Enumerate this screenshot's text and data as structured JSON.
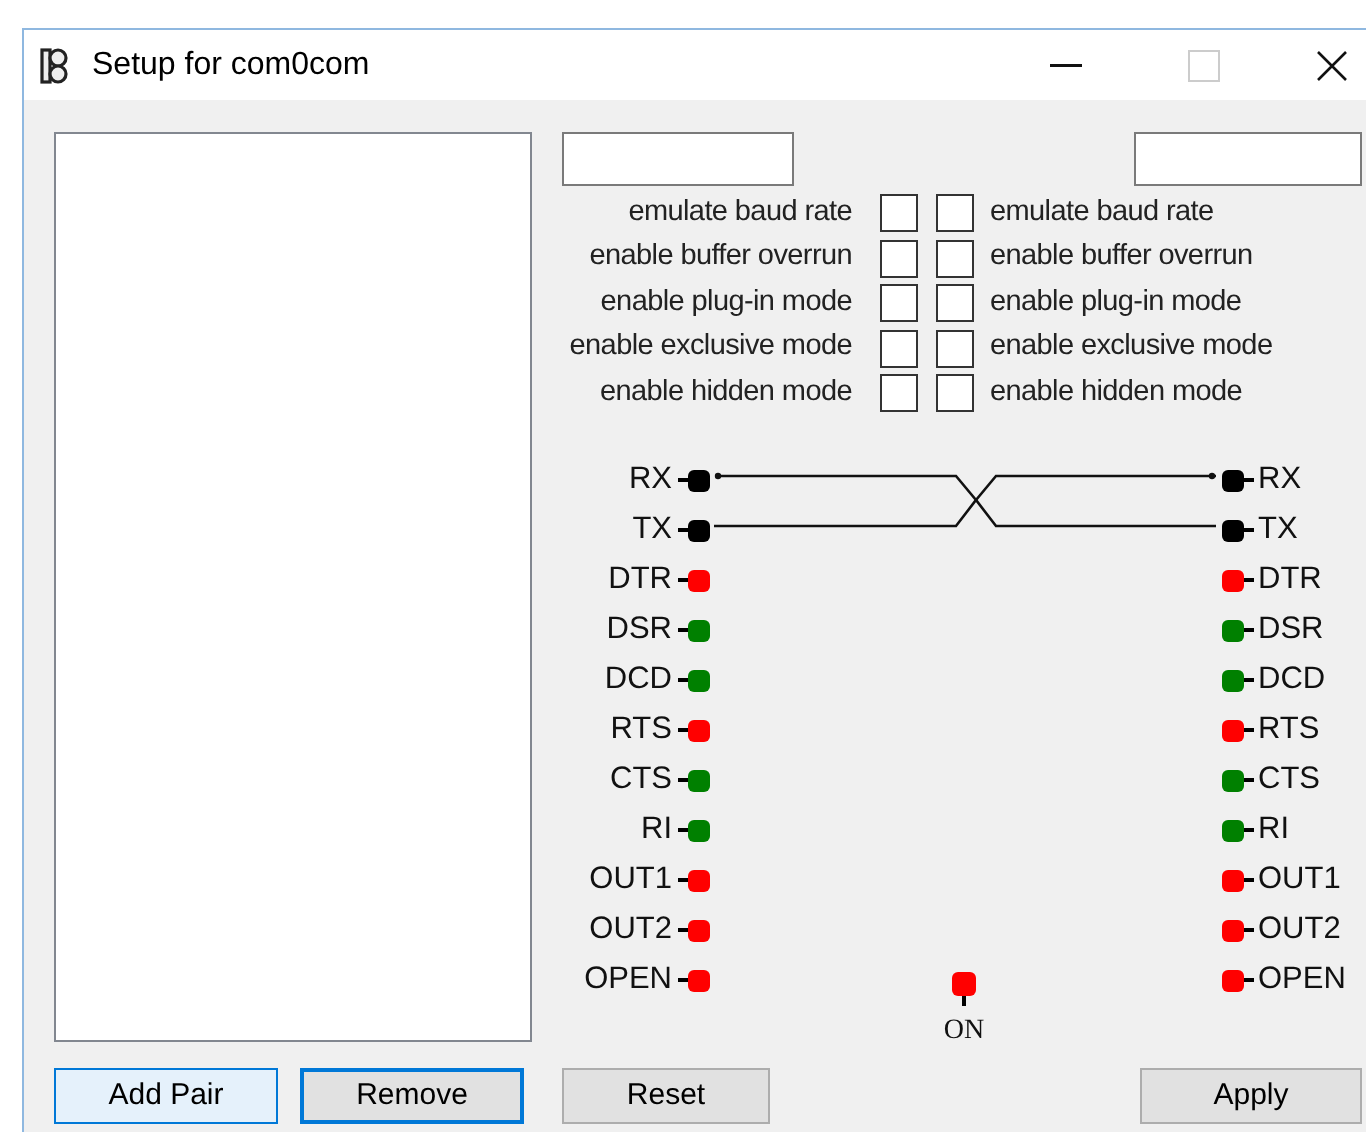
{
  "window": {
    "title": "Setup for com0com"
  },
  "options": [
    {
      "left": {
        "label": "emulate baud rate",
        "checked": false
      },
      "right": {
        "label": "emulate baud rate",
        "checked": false
      }
    },
    {
      "left": {
        "label": "enable buffer overrun",
        "checked": false
      },
      "right": {
        "label": "enable buffer overrun",
        "checked": false
      }
    },
    {
      "left": {
        "label": "enable plug-in mode",
        "checked": false
      },
      "right": {
        "label": "enable plug-in mode",
        "checked": false
      }
    },
    {
      "left": {
        "label": "enable exclusive mode",
        "checked": false
      },
      "right": {
        "label": "enable exclusive mode",
        "checked": false
      }
    },
    {
      "left": {
        "label": "enable hidden mode",
        "checked": false
      },
      "right": {
        "label": "enable hidden mode",
        "checked": false
      }
    }
  ],
  "signals": [
    {
      "left": {
        "name": "RX",
        "color": "#000000"
      },
      "right": {
        "name": "RX",
        "color": "#000000"
      }
    },
    {
      "left": {
        "name": "TX",
        "color": "#000000"
      },
      "right": {
        "name": "TX",
        "color": "#000000"
      }
    },
    {
      "left": {
        "name": "DTR",
        "color": "#ff0000"
      },
      "right": {
        "name": "DTR",
        "color": "#ff0000"
      }
    },
    {
      "left": {
        "name": "DSR",
        "color": "#008000"
      },
      "right": {
        "name": "DSR",
        "color": "#008000"
      }
    },
    {
      "left": {
        "name": "DCD",
        "color": "#008000"
      },
      "right": {
        "name": "DCD",
        "color": "#008000"
      }
    },
    {
      "left": {
        "name": "RTS",
        "color": "#ff0000"
      },
      "right": {
        "name": "RTS",
        "color": "#ff0000"
      }
    },
    {
      "left": {
        "name": "CTS",
        "color": "#008000"
      },
      "right": {
        "name": "CTS",
        "color": "#008000"
      }
    },
    {
      "left": {
        "name": "RI",
        "color": "#008000"
      },
      "right": {
        "name": "RI",
        "color": "#008000"
      }
    },
    {
      "left": {
        "name": "OUT1",
        "color": "#ff0000"
      },
      "right": {
        "name": "OUT1",
        "color": "#ff0000"
      }
    },
    {
      "left": {
        "name": "OUT2",
        "color": "#ff0000"
      },
      "right": {
        "name": "OUT2",
        "color": "#ff0000"
      }
    },
    {
      "left": {
        "name": "OPEN",
        "color": "#ff0000"
      },
      "right": {
        "name": "OPEN",
        "color": "#ff0000"
      }
    }
  ],
  "on_indicator": {
    "label": "ON",
    "color": "#ff0000"
  },
  "buttons": [
    {
      "label": "Add Pair",
      "kind": "hover"
    },
    {
      "label": "Remove",
      "kind": "focused"
    },
    {
      "label": "Reset",
      "kind": "normal"
    },
    {
      "label": "Apply",
      "kind": "normal"
    }
  ]
}
